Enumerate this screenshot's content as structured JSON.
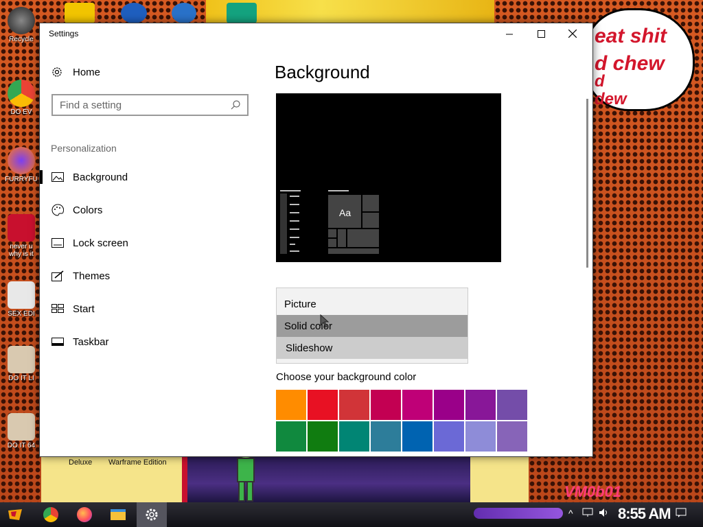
{
  "window": {
    "title": "Settings",
    "minimize_icon": "minimize-icon",
    "maximize_icon": "maximize-icon",
    "close_icon": "close-icon"
  },
  "nav": {
    "home_label": "Home",
    "search_placeholder": "Find a setting",
    "section_label": "Personalization",
    "items": [
      {
        "label": "Background",
        "icon": "picture-icon",
        "active": true
      },
      {
        "label": "Colors",
        "icon": "palette-icon",
        "active": false
      },
      {
        "label": "Lock screen",
        "icon": "lock-screen-icon",
        "active": false
      },
      {
        "label": "Themes",
        "icon": "brush-icon",
        "active": false
      },
      {
        "label": "Start",
        "icon": "start-icon",
        "active": false
      },
      {
        "label": "Taskbar",
        "icon": "taskbar-icon",
        "active": false
      }
    ]
  },
  "main": {
    "title": "Background",
    "preview_tile_text": "Aa",
    "dropdown_options": [
      "Picture",
      "Solid color",
      "Slideshow"
    ],
    "hovered_option": "Solid color",
    "selected_option": "Slideshow",
    "color_label": "Choose your background color",
    "colors_row1": [
      "#ff8c00",
      "#e81123",
      "#d13438",
      "#c30052",
      "#bf0077",
      "#9a0089",
      "#881798",
      "#744da9"
    ],
    "colors_row2": [
      "#10893e",
      "#107c10",
      "#018574",
      "#2d7d9a",
      "#0063b1",
      "#6b69d6",
      "#8e8cd8",
      "#8764b8"
    ]
  },
  "desktop": {
    "icons": [
      "Recycle",
      "DO EV",
      "FURRYFU",
      "never u\nwhy is it",
      "SEX EDI",
      "DO IT LI",
      "DO IT 64"
    ],
    "bubble_lines": [
      "eat shit",
      "d chew",
      "d",
      "dew"
    ],
    "lower_labels": [
      "Deluxe",
      "Warframe Edition"
    ],
    "vm_text": "VM0b01"
  },
  "taskbar": {
    "clock": "8:55 AM",
    "apps": [
      "start-icon",
      "chrome-icon",
      "firefox-icon",
      "file-explorer-icon",
      "settings-icon"
    ]
  }
}
